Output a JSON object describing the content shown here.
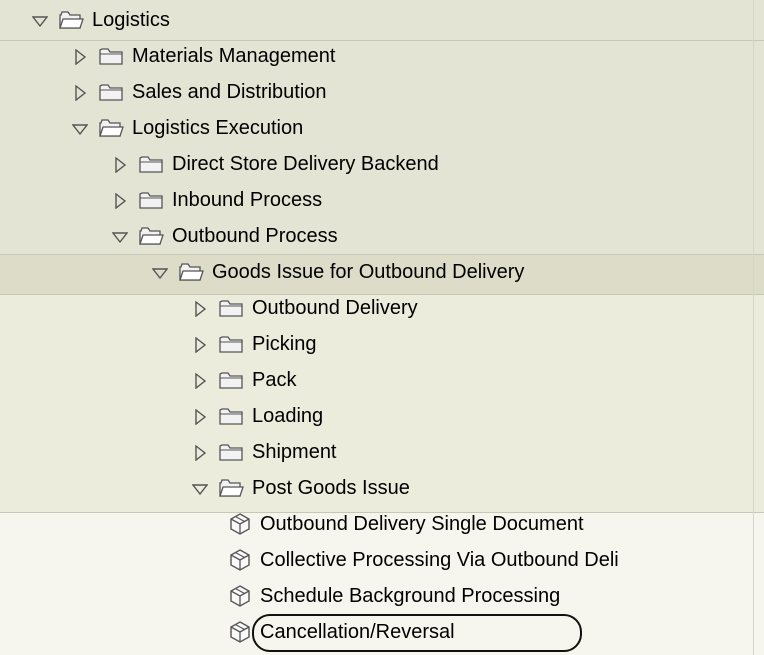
{
  "tree": {
    "nodes": [
      {
        "label": "Logistics",
        "level": 0,
        "state": "expanded",
        "type": "folder"
      },
      {
        "label": "Materials Management",
        "level": 1,
        "state": "collapsed",
        "type": "folder"
      },
      {
        "label": "Sales and Distribution",
        "level": 1,
        "state": "collapsed",
        "type": "folder"
      },
      {
        "label": "Logistics Execution",
        "level": 1,
        "state": "expanded",
        "type": "folder"
      },
      {
        "label": "Direct Store Delivery Backend",
        "level": 2,
        "state": "collapsed",
        "type": "folder"
      },
      {
        "label": "Inbound Process",
        "level": 2,
        "state": "collapsed",
        "type": "folder"
      },
      {
        "label": "Outbound Process",
        "level": 2,
        "state": "expanded",
        "type": "folder"
      },
      {
        "label": "Goods Issue for Outbound Delivery",
        "level": 3,
        "state": "expanded",
        "type": "folder"
      },
      {
        "label": "Outbound Delivery",
        "level": 4,
        "state": "collapsed",
        "type": "folder"
      },
      {
        "label": "Picking",
        "level": 4,
        "state": "collapsed",
        "type": "folder"
      },
      {
        "label": "Pack",
        "level": 4,
        "state": "collapsed",
        "type": "folder"
      },
      {
        "label": "Loading",
        "level": 4,
        "state": "collapsed",
        "type": "folder"
      },
      {
        "label": "Shipment",
        "level": 4,
        "state": "collapsed",
        "type": "folder"
      },
      {
        "label": "Post Goods Issue",
        "level": 4,
        "state": "expanded",
        "type": "folder"
      },
      {
        "label": "Outbound Delivery Single Document",
        "level": 5,
        "state": "leaf",
        "type": "transaction"
      },
      {
        "label": "Collective Processing Via Outbound Deli",
        "level": 5,
        "state": "leaf",
        "type": "transaction"
      },
      {
        "label": "Schedule Background Processing",
        "level": 5,
        "state": "leaf",
        "type": "transaction"
      },
      {
        "label": "Cancellation/Reversal",
        "level": 5,
        "state": "leaf",
        "type": "transaction",
        "highlighted": true
      }
    ],
    "icons": {
      "expanded": "triangle-down-icon",
      "collapsed": "triangle-right-icon",
      "folder_closed": "folder-icon",
      "folder_open": "folder-open-icon",
      "transaction": "cube-icon"
    },
    "colors": {
      "icon_stroke": "#555555",
      "folder_fill": "#f2f2f2",
      "highlight_border": "#111111"
    }
  }
}
